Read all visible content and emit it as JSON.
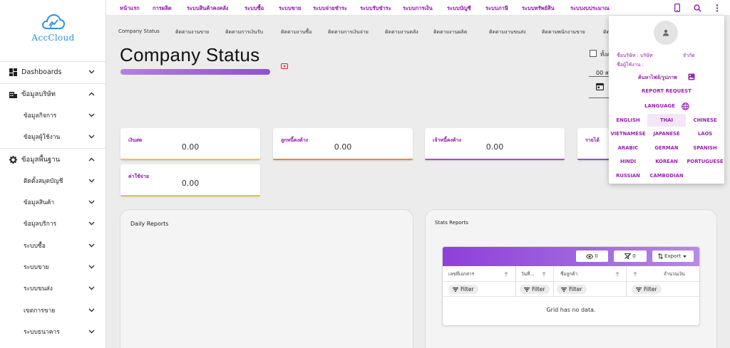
{
  "brand": {
    "name": "AccCloud",
    "primary_color": "#8e1aa8",
    "logo_color": "#2f8fe6"
  },
  "topnav": {
    "items": [
      "หน้าแรก",
      "การผลิต",
      "ระบบสินค้าคงคลัง",
      "ระบบซื้อ",
      "ระบบขาย",
      "ระบบจ่ายชำระ",
      "ระบบรับชำระ",
      "ระบบการเงิน",
      "ระบบบัญชี",
      "ระบบภาษี",
      "ระบบทรัพย์สิน",
      "ระบบงบประมาณ"
    ],
    "icons": [
      "phone-icon",
      "search-icon",
      "more-vert-icon"
    ]
  },
  "subtabs": [
    "Company Status",
    "ติดตามงานขาย",
    "ติดตามการเงินรับ",
    "ติดตามงานซื้อ",
    "ติดตามการเงินจ่าย",
    "ติดตามงานคลัง",
    "ติดตามงานผลิต",
    "ติดตามงานขนส่ง",
    "ติดตามพนักงานขาย",
    "ติด"
  ],
  "sidebar": {
    "items": [
      {
        "label": "Dashboards",
        "icon": "dashboard-icon",
        "expanded": false
      },
      {
        "label": "ข้อมูลบริษัท",
        "icon": "building-icon",
        "expanded": true
      },
      {
        "label": "ข้อมูลกิจการ",
        "sub": true
      },
      {
        "label": "ข้อมูลผู้ใช้งาน",
        "sub": true
      },
      {
        "label": "ข้อมูลพื้นฐาน",
        "icon": "gear-icon",
        "expanded": true
      },
      {
        "label": "ติดตั้งสมุดบัญชี",
        "sub": true
      },
      {
        "label": "ข้อมูลสินค้า",
        "sub": true
      },
      {
        "label": "ข้อมูลบริการ",
        "sub": true
      },
      {
        "label": "ระบบซื้อ",
        "sub": true
      },
      {
        "label": "ระบบขาย",
        "sub": true
      },
      {
        "label": "ระบบขนส่ง",
        "sub": true
      },
      {
        "label": "เขตการขาย",
        "sub": true
      },
      {
        "label": "ระบบธนาคาร",
        "sub": true
      }
    ]
  },
  "page": {
    "title": "Company Status",
    "checkbox_label": "ทั้งส",
    "period_value": "00 ส"
  },
  "kpis": [
    {
      "label": "เงินสด",
      "value": "0.00",
      "color": "#f0c040"
    },
    {
      "label": "ลูกหนี้คงค้าง",
      "value": "0.00",
      "color": "#f08040"
    },
    {
      "label": "เจ้าหนี้คงค้าง",
      "value": "0.00",
      "color": "#c040c8"
    },
    {
      "label": "รายได้",
      "value": "",
      "color": "#9050d8"
    },
    {
      "label": "ค่าใช้จ่าย",
      "value": "0.00",
      "color": "#f0c040"
    }
  ],
  "panels": {
    "daily_title": "Daily Reports",
    "stats_title": "Stats Reports"
  },
  "grid": {
    "toolbar": {
      "visible_count": "0",
      "filter_count": "0",
      "export_label": "Export"
    },
    "columns": [
      "เลขที่เอกสาร",
      "วันที่...",
      "ชื่อลูกค้า",
      "จำนวนเงิน"
    ],
    "filter_label": "Filter",
    "empty_text": "Grid has no data."
  },
  "account_menu": {
    "company_label": "ชื่อบริษัท : บริษัท",
    "company_suffix": "จำกัด",
    "user_label": "ชื่อผู้ใช้งาน :",
    "search_profile": "ค้นหาไฟล์/รูปภาพ",
    "report_request": "REPORT REQUEST",
    "language_label": "LANGUAGE",
    "languages": [
      "ENGLISH",
      "THAI",
      "CHINESE",
      "VIETNAMESE",
      "JAPANESE",
      "LAOS",
      "ARABIC",
      "GERMAN",
      "SPANISH",
      "HINDI",
      "KOREAN",
      "PORTUGUESE",
      "RUSSIAN",
      "CAMBODIAN"
    ],
    "selected_language": "THAI"
  }
}
